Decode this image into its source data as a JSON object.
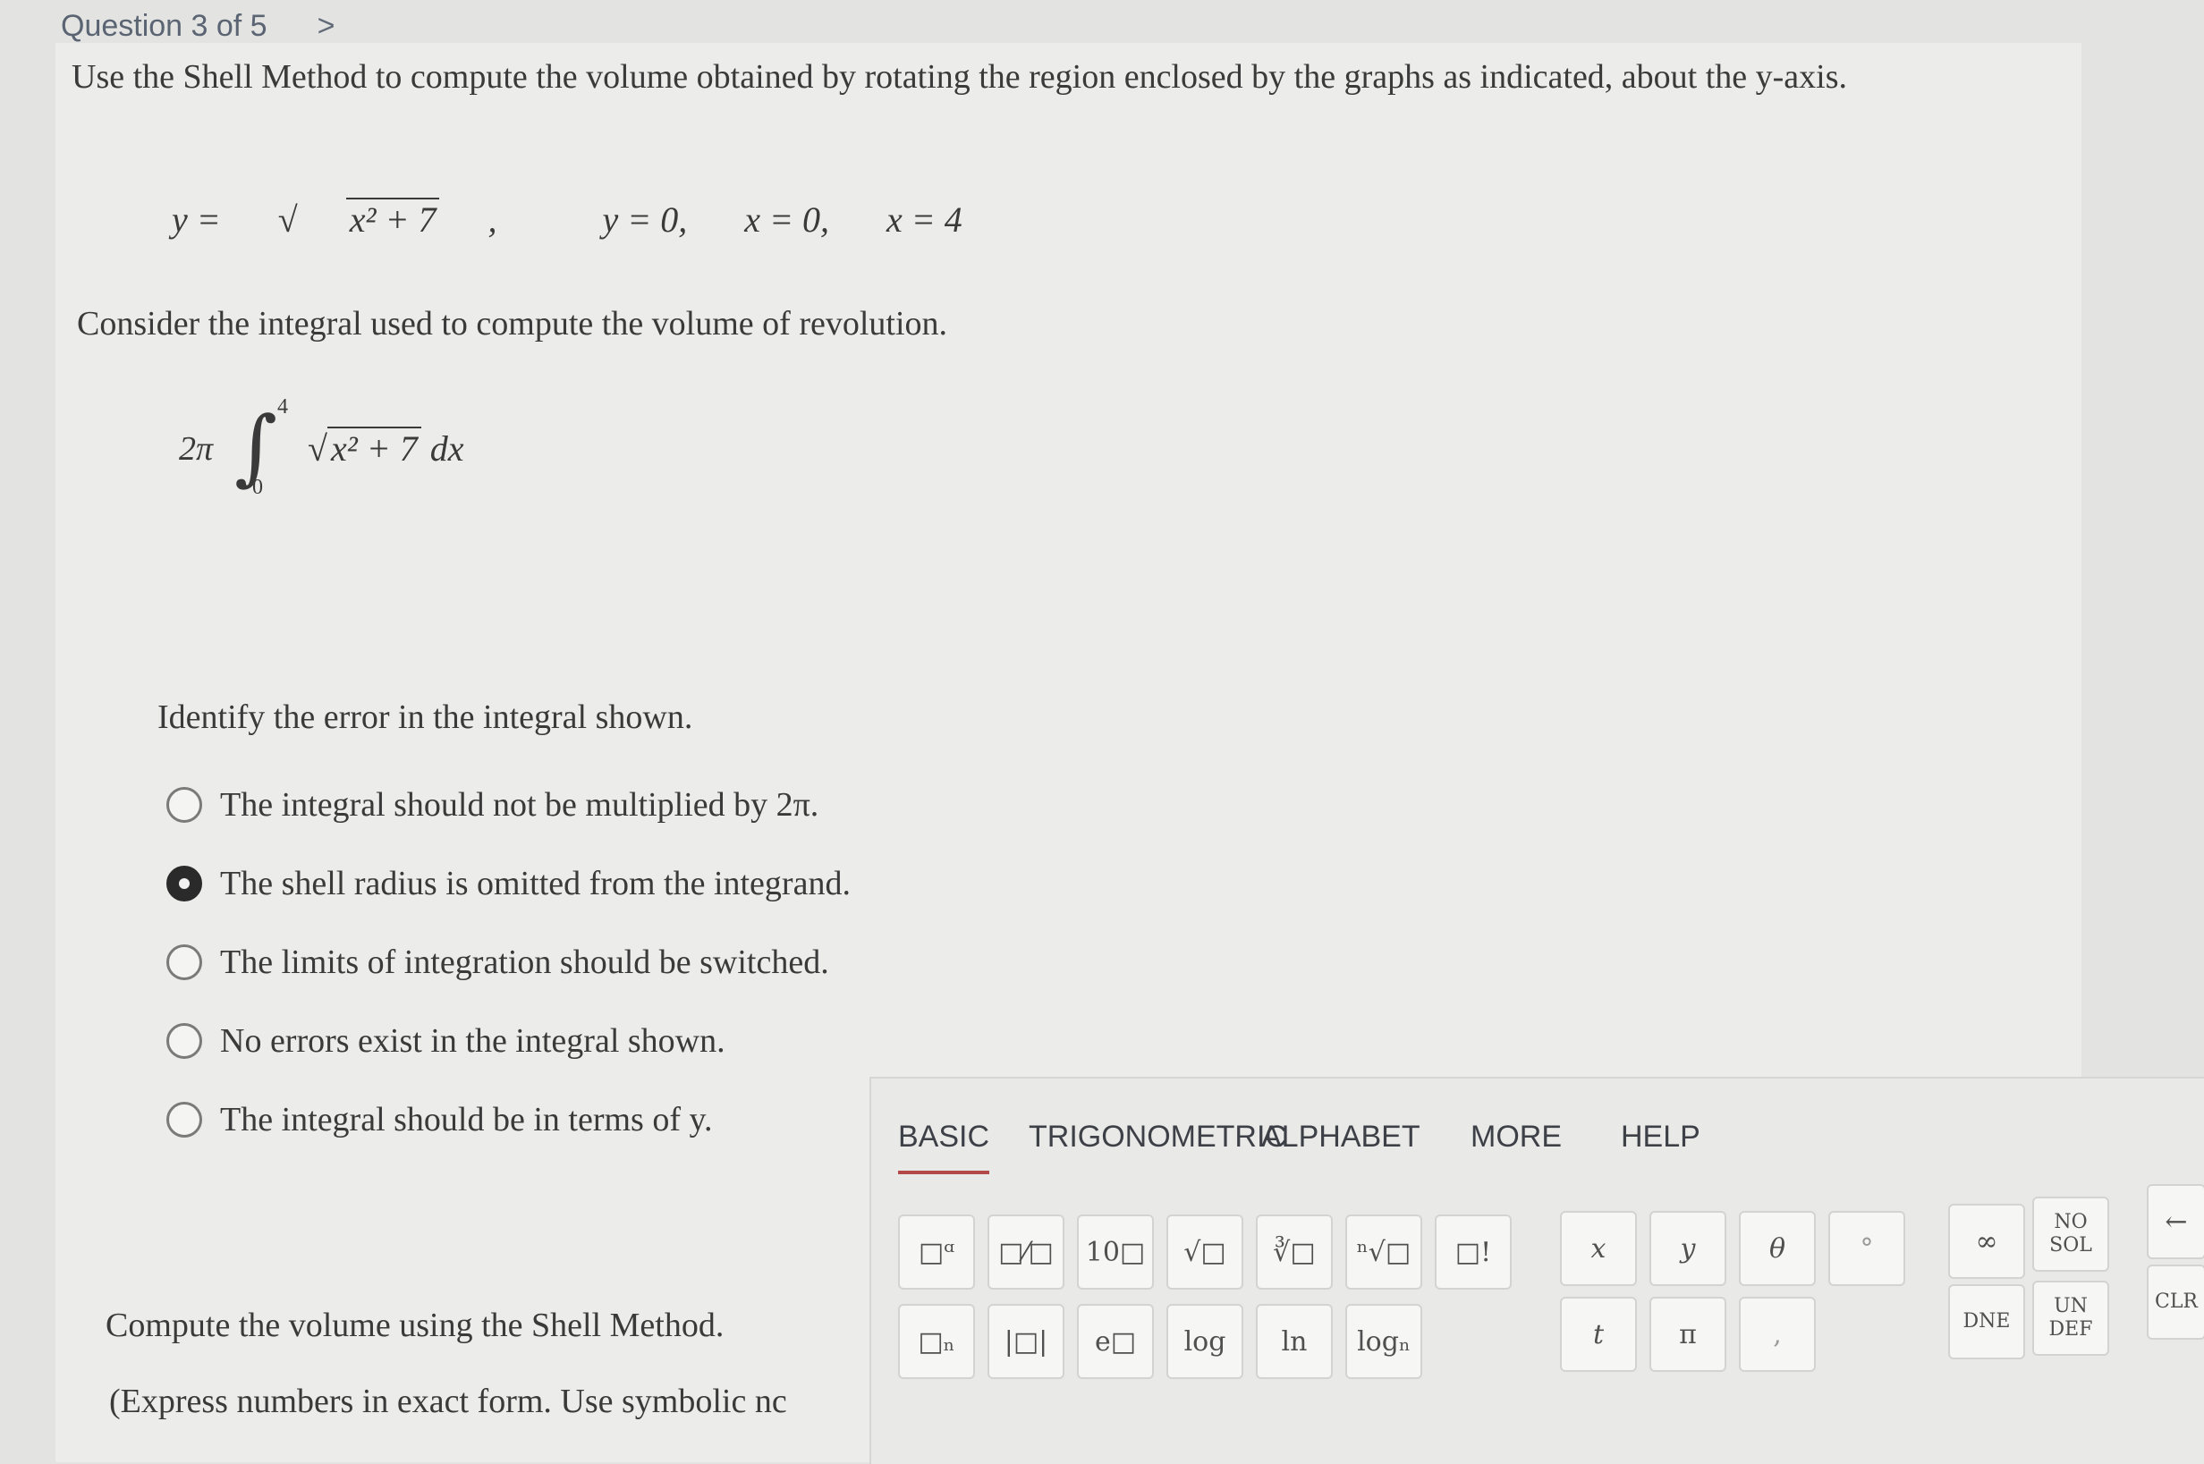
{
  "header": {
    "question": "Question 3 of 5",
    "next_icon": "chevron-right-icon",
    "next_glyph": ">"
  },
  "prompt": "Use the Shell Method to compute the volume obtained by rotating the region enclosed by the graphs as indicated, about the y-axis.",
  "equations": {
    "e1_lhs": "y = ",
    "e1_radicand": "x² + 7",
    "e1_tail": ",",
    "e2": "y = 0,",
    "e3": "x = 0,",
    "e4": "x = 4"
  },
  "consider": "Consider the integral used to compute the volume of revolution.",
  "integral": {
    "coef": "2π",
    "upper": "4",
    "lower": "0",
    "radicand": "x² + 7",
    "dx": " dx"
  },
  "identify": "Identify the error in the integral shown.",
  "options": [
    {
      "label": "The integral should not be multiplied by 2π.",
      "selected": false
    },
    {
      "label": "The shell radius is omitted from the integrand.",
      "selected": true
    },
    {
      "label": "The limits of integration should be switched.",
      "selected": false
    },
    {
      "label": "No errors exist in the integral shown.",
      "selected": false
    },
    {
      "label": "The integral should be in terms of y.",
      "selected": false
    }
  ],
  "compute": "Compute the volume using the Shell Method.",
  "express": "(Express numbers in exact form. Use symbolic nc",
  "keyboard": {
    "tabs": [
      "BASIC",
      "TRIGONOMETRIC",
      "ALPHABET",
      "MORE",
      "HELP"
    ],
    "active_tab": "BASIC",
    "keys": {
      "power": "□ᵅ",
      "fraction": "□⁄□",
      "ten_power": "10□",
      "sqrt": "√□",
      "cbrt": "∛□",
      "nroot": "ⁿ√□",
      "factorial": "□!",
      "subscript": "□ₙ",
      "abs": "|□|",
      "exp": "e□",
      "log": "log",
      "ln": "ln",
      "logn": "logₙ",
      "x": "x",
      "y": "y",
      "theta": "θ",
      "degree": "°",
      "t": "t",
      "pi": "π",
      "comma": ",",
      "infinity": "∞",
      "no_sol": "NO SOL",
      "dne": "DNE",
      "undef": "UN DEF",
      "backspace": "←",
      "clear": "CLR"
    }
  },
  "colors": {
    "accent": "#b24a4a",
    "background": "#ececea"
  }
}
